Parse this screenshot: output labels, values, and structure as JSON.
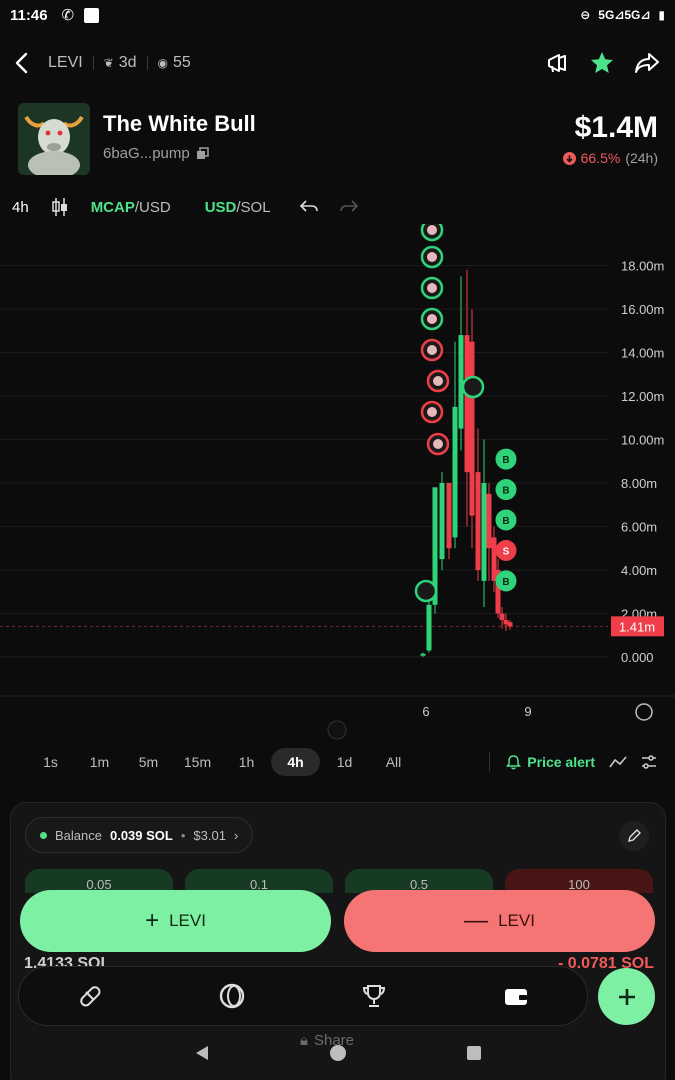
{
  "status_bar": {
    "time": "11:46",
    "network": "5G⊿5G⊿"
  },
  "header": {
    "ticker": "LEVI",
    "age": "3d",
    "watchers": "55"
  },
  "token": {
    "name": "The White Bull",
    "address": "6baG...pump",
    "price": "$1.4M",
    "change_pct": "66.5%",
    "change_period": "(24h)"
  },
  "chart_toolbar": {
    "interval": "4h",
    "mcap_label": "MCAP",
    "usd_label": "/USD",
    "usd2_label": "USD",
    "sol_label": "/SOL"
  },
  "chart_data": {
    "type": "candlestick",
    "y_ticks": [
      "18.00m",
      "16.00m",
      "14.00m",
      "12.00m",
      "10.00m",
      "8.00m",
      "6.00m",
      "4.00m",
      "2.00m",
      "0.000"
    ],
    "x_ticks": [
      "6",
      "9"
    ],
    "current_value_label": "1.41m",
    "candles": [
      {
        "o": 0.1,
        "h": 0.2,
        "l": 0.0,
        "c": 0.15
      },
      {
        "o": 0.3,
        "h": 3.0,
        "l": 0.2,
        "c": 2.4
      },
      {
        "o": 2.4,
        "h": 7.8,
        "l": 2.0,
        "c": 7.8
      },
      {
        "o": 4.5,
        "h": 8.5,
        "l": 4.0,
        "c": 8.0
      },
      {
        "o": 8.0,
        "h": 6.5,
        "l": 4.5,
        "c": 5.0
      },
      {
        "o": 5.5,
        "h": 14.5,
        "l": 5.0,
        "c": 11.5
      },
      {
        "o": 10.5,
        "h": 17.5,
        "l": 9.5,
        "c": 14.8
      },
      {
        "o": 14.8,
        "h": 17.8,
        "l": 6.0,
        "c": 8.5
      },
      {
        "o": 14.5,
        "h": 16.0,
        "l": 5.0,
        "c": 6.5
      },
      {
        "o": 8.5,
        "h": 10.5,
        "l": 3.5,
        "c": 4.0
      },
      {
        "o": 3.5,
        "h": 10.0,
        "l": 2.3,
        "c": 8.0
      },
      {
        "o": 7.5,
        "h": 8.0,
        "l": 3.5,
        "c": 5.0
      },
      {
        "o": 5.5,
        "h": 6.0,
        "l": 3.0,
        "c": 3.5
      },
      {
        "o": 4.0,
        "h": 4.5,
        "l": 1.8,
        "c": 2.0
      },
      {
        "o": 2.0,
        "h": 2.3,
        "l": 1.3,
        "c": 1.7
      },
      {
        "o": 1.7,
        "h": 2.0,
        "l": 1.2,
        "c": 1.5
      },
      {
        "o": 1.6,
        "h": 1.7,
        "l": 1.25,
        "c": 1.41
      }
    ],
    "markers": [
      {
        "kind": "B",
        "value": 9.1
      },
      {
        "kind": "B",
        "value": 7.7
      },
      {
        "kind": "B",
        "value": 6.3
      },
      {
        "kind": "S",
        "value": 4.9
      },
      {
        "kind": "B",
        "value": 3.5
      }
    ]
  },
  "timeframes": {
    "items": [
      "1s",
      "1m",
      "5m",
      "15m",
      "1h",
      "4h",
      "1d",
      "All"
    ],
    "active": "4h",
    "price_alert": "Price alert"
  },
  "trade": {
    "balance_label": "Balance",
    "balance_sol": "0.039 SOL",
    "balance_usd": "$3.01",
    "amounts": [
      "0.05",
      "0.1",
      "0.5",
      "100"
    ],
    "buy_label": "LEVI",
    "sell_label": "LEVI",
    "holding_sol": "1.4133 SOL",
    "pnl_sol": "- 0.0781 SOL",
    "share_label": "Share"
  },
  "colors": {
    "green": "#4ee38b",
    "red": "#ef5b5b",
    "buy_btn": "#7ef0a4",
    "sell_btn": "#f57575"
  }
}
